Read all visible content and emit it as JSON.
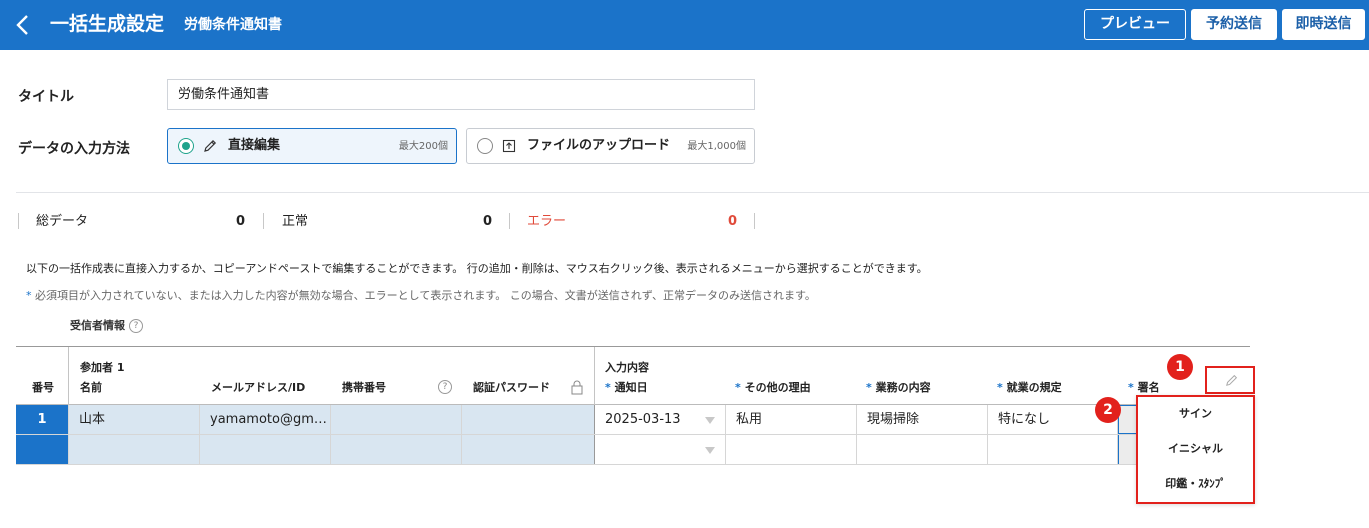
{
  "header": {
    "title": "一括生成設定",
    "document_name": "労働条件通知書",
    "preview_label": "プレビュー",
    "schedule_label": "予約送信",
    "send_now_label": "即時送信",
    "background_color": "#1b73c9"
  },
  "form": {
    "title_label": "タイトル",
    "title_value": "労働条件通知書",
    "input_method_label": "データの入力方法",
    "options": [
      {
        "label": "直接編集",
        "max": "最大200個",
        "selected": true,
        "icon": "pencil-icon"
      },
      {
        "label": "ファイルのアップロード",
        "max": "最大1,000個",
        "selected": false,
        "icon": "upload-icon"
      }
    ]
  },
  "stats": {
    "total_label": "総データ",
    "total_value": "0",
    "normal_label": "正常",
    "normal_value": "0",
    "error_label": "エラー",
    "error_value": "0",
    "error_color": "#e04a3a"
  },
  "notes": {
    "line1": "以下の一括作成表に直接入力するか、コピーアンドペーストで編集することができます。 行の追加・削除は、マウス右クリック後、表示されるメニューから選択することができます。",
    "line2_asterisk": "*",
    "line2": " 必須項目が入力されていない、または入力した内容が無効な場合、エラーとして表示されます。 この場合、文書が送信されず、正常データのみ送信されます。"
  },
  "recipient_info_label": "受信者情報",
  "table": {
    "headers": {
      "number": "番号",
      "participant_group": "参加者 1",
      "name": "名前",
      "email": "メールアドレス/ID",
      "phone": "携帯番号",
      "password": "認証パスワード",
      "input_group": "入力内容",
      "notice_date": "通知日",
      "other_reason": "その他の理由",
      "work_content": "業務の内容",
      "employment_rules": "就業の規定",
      "signature": "署名"
    },
    "required_mark": "*",
    "rows": [
      {
        "number": "1",
        "name": "山本",
        "email": "yamamoto@gm…",
        "phone": "",
        "password": "",
        "notice_date": "2025-03-13",
        "other_reason": "私用",
        "work_content": "現場掃除",
        "employment_rules": "特になし"
      },
      {
        "number": "",
        "name": "",
        "email": "",
        "phone": "",
        "password": "",
        "notice_date": "",
        "other_reason": "",
        "work_content": "",
        "employment_rules": ""
      }
    ]
  },
  "callouts": {
    "badge1": "1",
    "badge2": "2",
    "highlight_color": "#e2211c"
  },
  "signature_menu": {
    "items": [
      "サイン",
      "イニシャル",
      "印鑑・ｽﾀﾝﾌﾟ"
    ]
  }
}
